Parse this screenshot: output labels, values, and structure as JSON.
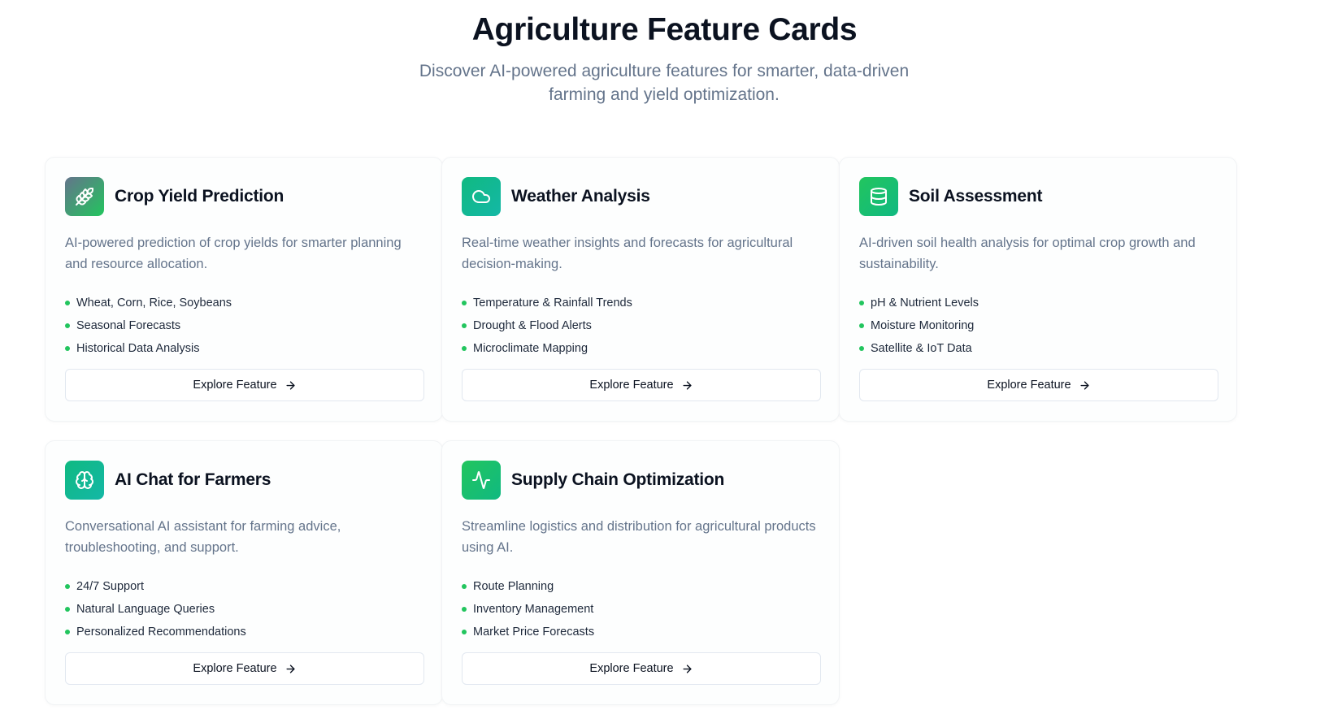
{
  "header": {
    "title": "Agriculture Feature Cards",
    "subtitle": "Discover AI-powered agriculture features for smarter, data-driven farming and yield optimization."
  },
  "cards": [
    {
      "title": "Crop Yield Prediction",
      "description": "AI-powered prediction of crop yields for smarter planning and resource allocation.",
      "icon": "wheat-icon",
      "features": [
        "Wheat, Corn, Rice, Soybeans",
        "Seasonal Forecasts",
        "Historical Data Analysis"
      ],
      "button_label": "Explore Feature"
    },
    {
      "title": "Weather Analysis",
      "description": "Real-time weather insights and forecasts for agricultural decision-making.",
      "icon": "cloud-icon",
      "features": [
        "Temperature & Rainfall Trends",
        "Drought & Flood Alerts",
        "Microclimate Mapping"
      ],
      "button_label": "Explore Feature"
    },
    {
      "title": "Soil Assessment",
      "description": "AI-driven soil health analysis for optimal crop growth and sustainability.",
      "icon": "database-icon",
      "features": [
        "pH & Nutrient Levels",
        "Moisture Monitoring",
        "Satellite & IoT Data"
      ],
      "button_label": "Explore Feature"
    },
    {
      "title": "AI Chat for Farmers",
      "description": "Conversational AI assistant for farming advice, troubleshooting, and support.",
      "icon": "brain-icon",
      "features": [
        "24/7 Support",
        "Natural Language Queries",
        "Personalized Recommendations"
      ],
      "button_label": "Explore Feature"
    },
    {
      "title": "Supply Chain Optimization",
      "description": "Streamline logistics and distribution for agricultural products using AI.",
      "icon": "activity-icon",
      "features": [
        "Route Planning",
        "Inventory Management",
        "Market Price Forecasts"
      ],
      "button_label": "Explore Feature"
    }
  ],
  "colors": {
    "accent_green": "#22c55e",
    "icon_gradient_slate_green": [
      "#64748b",
      "#22c55e"
    ],
    "icon_gradient_teal": [
      "#10b981",
      "#14b8a6"
    ],
    "icon_gradient_green": [
      "#22c55e",
      "#10b981"
    ]
  }
}
